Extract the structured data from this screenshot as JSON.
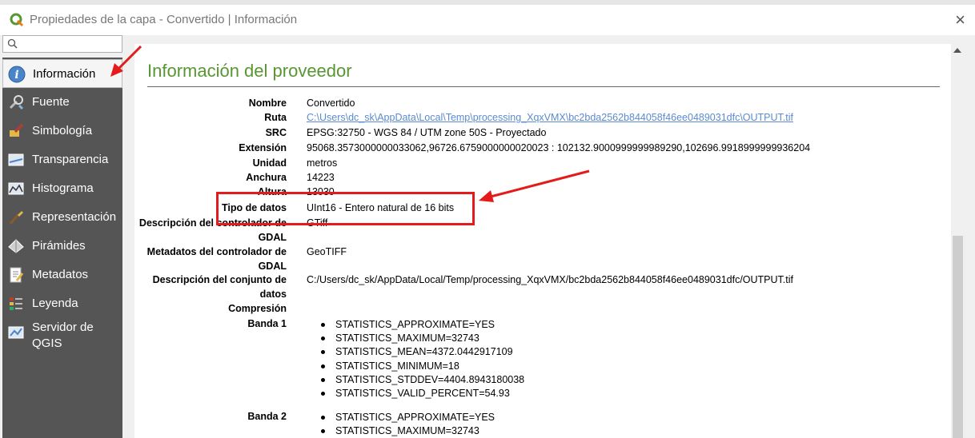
{
  "window": {
    "title": "Propiedades de la capa - Convertido | Información",
    "close_label": "×"
  },
  "search": {
    "placeholder": ""
  },
  "sidebar": {
    "items": [
      {
        "label": "Información",
        "icon": "info-icon"
      },
      {
        "label": "Fuente",
        "icon": "source-icon"
      },
      {
        "label": "Simbología",
        "icon": "symbology-icon"
      },
      {
        "label": "Transparencia",
        "icon": "transparency-icon"
      },
      {
        "label": "Histograma",
        "icon": "histogram-icon"
      },
      {
        "label": "Representación",
        "icon": "rendering-icon"
      },
      {
        "label": "Pirámides",
        "icon": "pyramids-icon"
      },
      {
        "label": "Metadatos",
        "icon": "metadata-icon"
      },
      {
        "label": "Leyenda",
        "icon": "legend-icon"
      },
      {
        "label": "Servidor de QGIS",
        "icon": "server-icon"
      }
    ]
  },
  "info": {
    "section_title": "Información del proveedor",
    "fields": [
      {
        "key": "Nombre",
        "value": "Convertido"
      },
      {
        "key": "Ruta",
        "value": "C:\\Users\\dc_sk\\AppData\\Local\\Temp\\processing_XqxVMX\\bc2bda2562b844058f46ee0489031dfc\\OUTPUT.tif"
      },
      {
        "key": "SRC",
        "value": "EPSG:32750 - WGS 84 / UTM zone 50S - Proyectado"
      },
      {
        "key": "Extensión",
        "value": "95068.3573000000033062,96726.6759000000020023 : 102132.9000999999989290,102696.9918999999936204"
      },
      {
        "key": "Unidad",
        "value": "metros"
      },
      {
        "key": "Anchura",
        "value": "14223"
      },
      {
        "key": "Altura",
        "value": "13030"
      },
      {
        "key": "Tipo de datos",
        "value": "UInt16 - Entero natural de 16 bits"
      },
      {
        "key": "Descripción del controlador de GDAL",
        "value": "GTiff"
      },
      {
        "key": "Metadatos del controlador de GDAL",
        "value": "GeoTIFF"
      },
      {
        "key": "Descripción del conjunto de datos",
        "value": "C:/Users/dc_sk/AppData/Local/Temp/processing_XqxVMX/bc2bda2562b844058f46ee0489031dfc/OUTPUT.tif"
      },
      {
        "key": "Compresión",
        "value": ""
      }
    ],
    "bands": [
      {
        "label": "Banda 1",
        "stats": [
          "STATISTICS_APPROXIMATE=YES",
          "STATISTICS_MAXIMUM=32743",
          "STATISTICS_MEAN=4372.0442917109",
          "STATISTICS_MINIMUM=18",
          "STATISTICS_STDDEV=4404.8943180038",
          "STATISTICS_VALID_PERCENT=54.93"
        ]
      },
      {
        "label": "Banda 2",
        "stats": [
          "STATISTICS_APPROXIMATE=YES",
          "STATISTICS_MAXIMUM=32743"
        ]
      }
    ]
  },
  "colors": {
    "accent_green": "#589632",
    "annotation_red": "#e31b1b",
    "sidebar_bg": "#555555",
    "link_blue": "#5b8bd0"
  }
}
